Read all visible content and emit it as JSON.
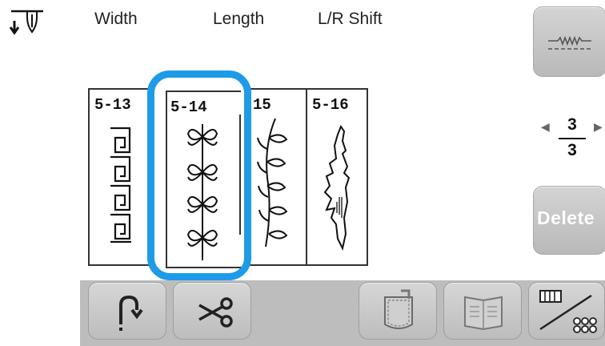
{
  "header": {
    "width_label": "Width",
    "length_label": "Length",
    "shift_label": "L/R Shift"
  },
  "patterns": [
    {
      "label": "5-13"
    },
    {
      "label": "5-14"
    },
    {
      "label": "15"
    },
    {
      "label": "5-16"
    }
  ],
  "selected_pattern": "5-14",
  "pagination": {
    "current": "3",
    "total": "3"
  },
  "side_buttons": {
    "delete_label": "Delete"
  },
  "icons": {
    "needle": "needle-position-icon",
    "stitch_type": "zigzag-stitch-icon",
    "reverse": "reverse-stitch-icon",
    "scissors": "scissors-icon",
    "pocket": "pocket-icon",
    "pattern_guide": "stitch-guide-icon",
    "grid": "pattern-grid-icon"
  },
  "colors": {
    "selection": "#1e9be8",
    "toolbar": "#bdbdbd"
  }
}
